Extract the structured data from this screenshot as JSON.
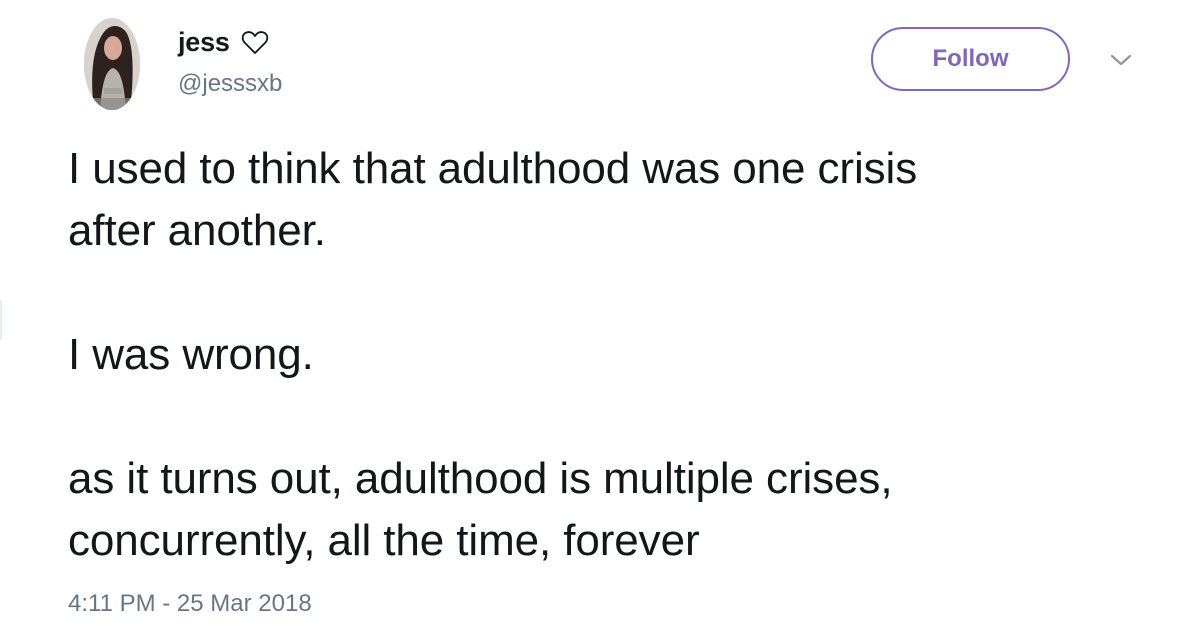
{
  "user": {
    "display_name": "jess",
    "handle": "@jesssxb"
  },
  "actions": {
    "follow_label": "Follow",
    "menu_icon": "chevron-down-icon"
  },
  "tweet": {
    "paragraphs": [
      "I used to think that adulthood was one crisis\nafter another.",
      "I was wrong.",
      "as it turns out, adulthood is multiple crises,\nconcurrently, all the time, forever"
    ],
    "timestamp": "4:11 PM - 25 Mar 2018"
  },
  "colors": {
    "accent": "#8067bd",
    "text": "#14171a",
    "secondary_text": "#657786",
    "background": "#ffffff"
  },
  "icons": {
    "name_badge": "heart-outline-icon"
  }
}
